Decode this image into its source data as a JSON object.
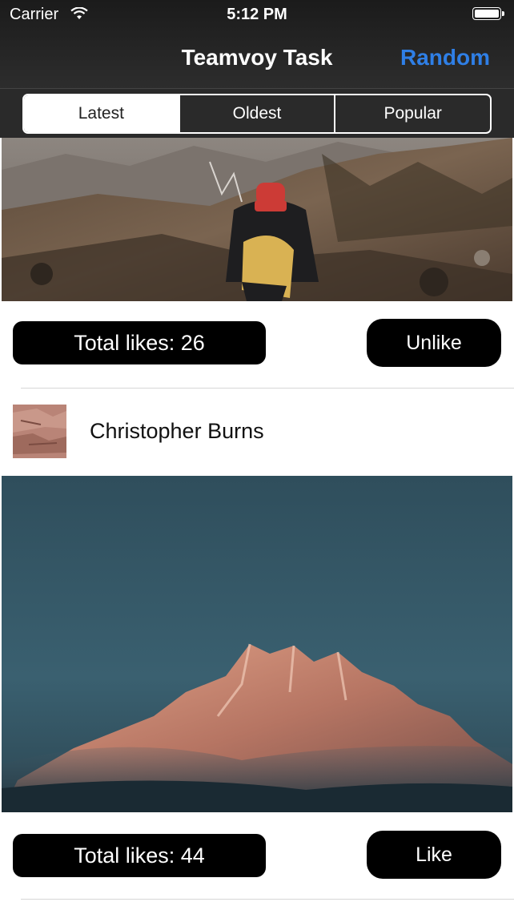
{
  "status_bar": {
    "carrier": "Carrier",
    "time": "5:12 PM",
    "wifi_icon": "wifi-icon",
    "battery_icon": "battery-icon"
  },
  "nav": {
    "title": "Teamvoy Task",
    "random_label": "Random",
    "accent_color": "#2f7fe6"
  },
  "segments": {
    "items": [
      "Latest",
      "Oldest",
      "Popular"
    ],
    "selected": "Latest"
  },
  "feed": {
    "posts": [
      {
        "likes_text": "Total likes: 26",
        "button_label": "Unlike",
        "photo": "hiker-on-mountain-trail"
      },
      {
        "author": "Christopher Burns",
        "likes_text": "Total likes: 44",
        "button_label": "Like",
        "photo": "snow-mountain-peak-at-sunset"
      }
    ]
  }
}
